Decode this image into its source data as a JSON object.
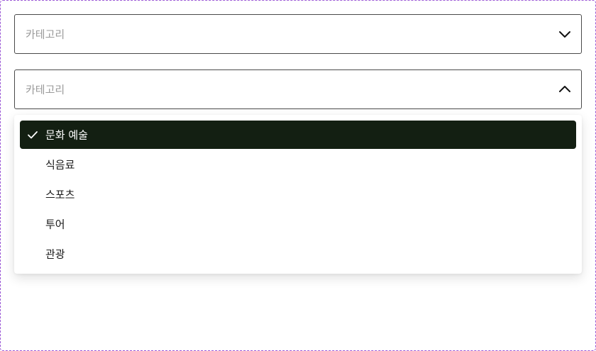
{
  "select_closed": {
    "placeholder": "카테고리",
    "state": "collapsed",
    "icon": "chevron-down-icon"
  },
  "select_open": {
    "placeholder": "카테고리",
    "state": "expanded",
    "icon": "chevron-up-icon"
  },
  "menu": {
    "options": [
      {
        "label": "문화 예술",
        "selected": true,
        "icon": "check-icon"
      },
      {
        "label": "식음료",
        "selected": false
      },
      {
        "label": "스포츠",
        "selected": false
      },
      {
        "label": "투어",
        "selected": false
      },
      {
        "label": "관광",
        "selected": false
      }
    ]
  },
  "colors": {
    "selected_bg": "#131f12",
    "selected_text": "#ffffff",
    "placeholder_text": "#9a9a9a",
    "border": "#4a4a4a",
    "frame_dash": "#9b59d6"
  }
}
